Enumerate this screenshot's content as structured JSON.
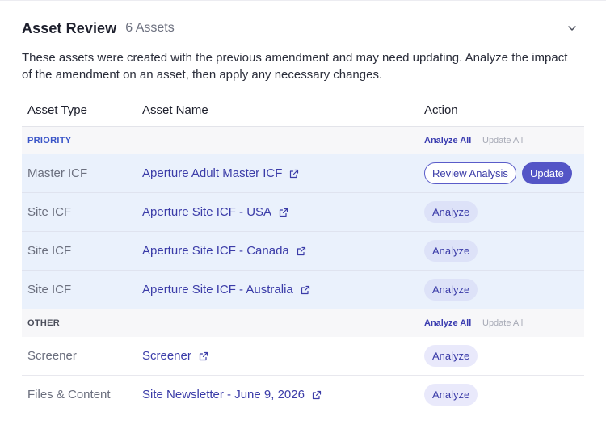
{
  "header": {
    "title": "Asset Review",
    "count": "6 Assets"
  },
  "description": "These assets were created with the previous amendment and may need updating. Analyze the impact of the amendment on an asset, then apply any necessary changes.",
  "columns": {
    "type": "Asset Type",
    "name": "Asset Name",
    "action": "Action"
  },
  "groups": {
    "priority": {
      "label": "PRIORITY",
      "analyze_all": "Analyze All",
      "update_all": "Update All"
    },
    "other": {
      "label": "OTHER",
      "analyze_all": "Analyze All",
      "update_all": "Update All"
    }
  },
  "rows": [
    {
      "type": "Master ICF",
      "name": "Aperture Adult Master ICF",
      "review": "Review Analysis",
      "update": "Update"
    },
    {
      "type": "Site ICF",
      "name": "Aperture Site ICF - USA",
      "analyze": "Analyze"
    },
    {
      "type": "Site ICF",
      "name": "Aperture Site ICF - Canada",
      "analyze": "Analyze"
    },
    {
      "type": "Site ICF",
      "name": "Aperture Site ICF - Australia",
      "analyze": "Analyze"
    },
    {
      "type": "Screener",
      "name": "Screener",
      "analyze": "Analyze"
    },
    {
      "type": "Files & Content",
      "name": "Site Newsletter - June 9, 2026",
      "analyze": "Analyze"
    }
  ],
  "colors": {
    "accent": "#5455c6",
    "link": "#3b3ca8",
    "highlight_row": "#eaf1fc"
  },
  "icons": {
    "collapse": "chevron-down-icon",
    "external": "external-link-icon"
  }
}
